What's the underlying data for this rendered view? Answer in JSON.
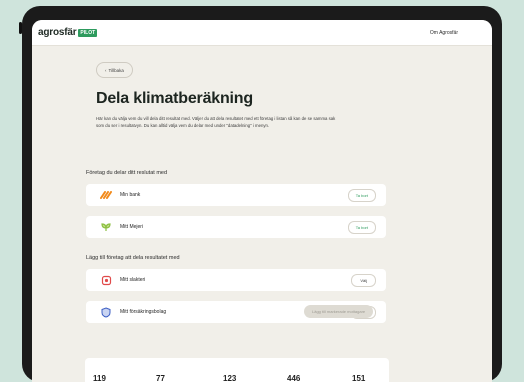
{
  "header": {
    "logo_text": "agrosfär",
    "logo_badge": "PILOT",
    "nav_link": "Om Agrosfär"
  },
  "back_button": {
    "label": "Tillbaka",
    "icon": "chevron-left-icon"
  },
  "page": {
    "title": "Dela klimatberäkning",
    "description": "Här kan du välja vem du vill dela ditt resultat med. Väljer du att dela resultatet med ett företag i listan så kan de se samma sak som du ser i resultatvyn. Du kan alltid välja vem du delar med under \"datadelning\" i menyn."
  },
  "shared_section": {
    "title": "Företag du delar ditt reslutat med",
    "items": [
      {
        "name": "Min bank",
        "action": "Ta bort",
        "icon": "bank-logo-icon"
      },
      {
        "name": "Mitt Mejeri",
        "action": "Ta bort",
        "icon": "dairy-logo-icon"
      }
    ]
  },
  "add_section": {
    "title": "Lägg till företag att dela resultatet med",
    "items": [
      {
        "name": "Mitt slakteri",
        "action": "Välj",
        "icon": "slaughterhouse-logo-icon"
      },
      {
        "name": "Mitt försäkringsbolag",
        "action": "Välj",
        "icon": "insurance-shield-icon"
      }
    ]
  },
  "share_button": {
    "label": "Lägg till markerade mottagare"
  },
  "stats": [
    "119",
    "77",
    "123",
    "446",
    "151"
  ],
  "colors": {
    "accent": "#2e9b5e",
    "background": "#cfe4dc",
    "screen_bg": "#f1efe9",
    "bank_icon": "#f28a1b",
    "dairy_icon": "#8bbf3f",
    "slaughter_icon": "#e04a4a",
    "insurance_icon": "#3d5fc4"
  }
}
